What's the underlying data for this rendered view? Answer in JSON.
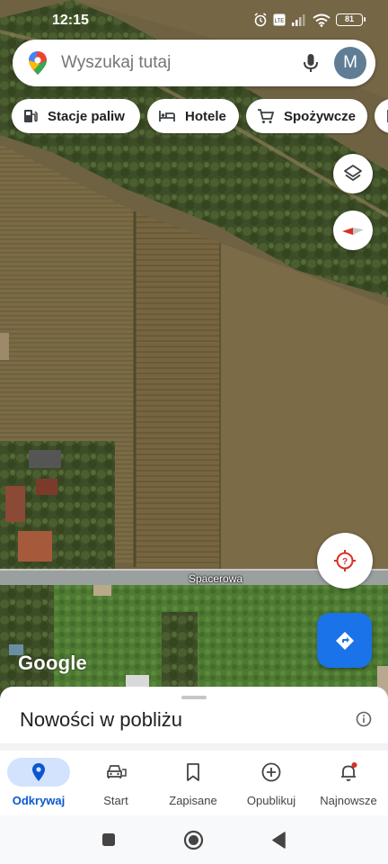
{
  "status_bar": {
    "time": "12:15",
    "battery": "81",
    "icons": [
      "alarm-icon",
      "volte-icon",
      "signal-icon",
      "wifi-icon",
      "battery-icon"
    ]
  },
  "search": {
    "placeholder": "Wyszukaj tutaj",
    "avatar_letter": "M"
  },
  "chips": [
    {
      "label": "Stacje paliw",
      "icon": "gas-station-icon"
    },
    {
      "label": "Hotele",
      "icon": "hotel-bed-icon"
    },
    {
      "label": "Spożywcze",
      "icon": "shopping-cart-icon"
    }
  ],
  "map": {
    "road_label": "Spacerowa",
    "logo": "Google",
    "buttons": [
      "layers-icon",
      "compass-icon",
      "location-unknown-icon",
      "directions-icon"
    ]
  },
  "sheet": {
    "title": "Nowości w pobliżu"
  },
  "bottom_nav": {
    "items": [
      {
        "label": "Odkrywaj",
        "icon": "explore-pin-icon",
        "active": true
      },
      {
        "label": "Start",
        "icon": "car-icon",
        "active": false
      },
      {
        "label": "Zapisane",
        "icon": "bookmark-icon",
        "active": false
      },
      {
        "label": "Opublikuj",
        "icon": "add-circle-icon",
        "active": false
      },
      {
        "label": "Najnowsze",
        "icon": "bell-icon",
        "active": false
      }
    ]
  },
  "system_nav": [
    "recents-square-icon",
    "home-circle-icon",
    "back-triangle-icon"
  ],
  "colors": {
    "accent": "#1a73e8",
    "active_pill": "#d3e3fd",
    "field": "#6b5f3f"
  }
}
